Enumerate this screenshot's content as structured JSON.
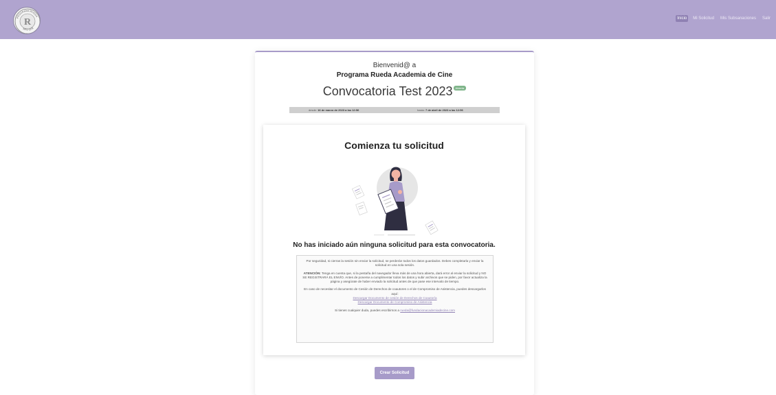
{
  "nav": {
    "logo_text": [
      "PROGRAMA RUEDA",
      "MÁS QUE"
    ],
    "links": [
      {
        "label": "Inicio",
        "active": true
      },
      {
        "label": "Mi Solicitud",
        "active": false
      },
      {
        "label": "Mis Subsanaciones",
        "active": false
      },
      {
        "label": "Salir",
        "active": false
      }
    ]
  },
  "header": {
    "welcome": "Bienvenid@ a",
    "program": "Programa Rueda Academia de Cine",
    "convocatoria": "Convocatoria Test 2023",
    "badge": "Abierta",
    "date_from_label": "desde:",
    "date_from": "16 de marzo de 2023 a las 12:56",
    "date_to_label": "hasta:",
    "date_to": "7 de abril de 2023 a las 12:56"
  },
  "start": {
    "title": "Comienza tu solicitud",
    "no_solicitud": "No has iniciado aún ninguna solicitud para esta convocatoria."
  },
  "info": {
    "p1": "Por seguridad, si cierras la sesión sin enviar la solicitud, se perderán todos los datos guardados. Debes completarla y enviar la solicitud en una sola sesión.",
    "attention_label": "ATENCIÓN:",
    "p2": "Tenga en cuenta que, si la pestaña del navegador lleva más de una hora abierta, dará error al enviar la solicitud y NO SE REGISTRARÁ EL ENVÍO. Antes de ponerse a cumplimentar todos los datos y subir archivos que se piden, por favor actualiza la página y asegúrate de haber enviado la solicitud antes de que pase ese intervalo de tiempo.",
    "p3": "En caso de necesitar el documento de Cesión de Derechos de coautores o el de Compromiso de Asistencia, puedes descargarlos aquí:",
    "link1": "Descargar Documento de cesión de Derechos de Coautoría",
    "link2": "Descargar Documento de Compromiso de Asistencia",
    "contact_text": "Si tienes cualquier duda, puedes escribirnos a",
    "contact_email": "rueda@fundacionacademiadecine.com"
  },
  "actions": {
    "create_label": "Crear Solicitud"
  },
  "colors": {
    "navbar": "#b0a4cf",
    "accent": "#a79bc9",
    "badge": "#7fb58a"
  }
}
